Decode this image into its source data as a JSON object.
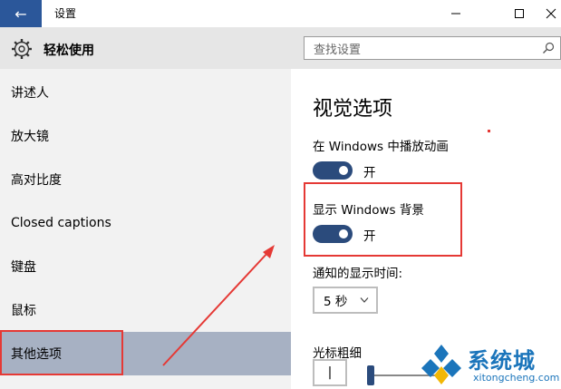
{
  "window": {
    "title": "设置",
    "back_glyph": "←",
    "min_glyph": "—",
    "max_glyph": "☐",
    "close_glyph": "✕"
  },
  "sidebar": {
    "title": "轻松使用",
    "items": [
      {
        "label": "讲述人"
      },
      {
        "label": "放大镜"
      },
      {
        "label": "高对比度"
      },
      {
        "label": "Closed captions"
      },
      {
        "label": "键盘"
      },
      {
        "label": "鼠标"
      },
      {
        "label": "其他选项"
      }
    ]
  },
  "search": {
    "placeholder": "查找设置"
  },
  "main": {
    "section_title": "视觉选项",
    "animations_label": "在 Windows 中播放动画",
    "animations_state": "开",
    "background_label": "显示 Windows 背景",
    "background_state": "开",
    "notify_label": "通知的显示时间:",
    "notify_value": "5 秒",
    "cursor_label": "光标粗细",
    "cursor_value": "|"
  },
  "watermark": {
    "main": "系统城",
    "sub": "xitongcheng.com"
  },
  "colors": {
    "accent": "#2b579a",
    "toggle_on": "#2b4b7c",
    "selected": "#a7b1c3",
    "annotation": "#e53935"
  }
}
